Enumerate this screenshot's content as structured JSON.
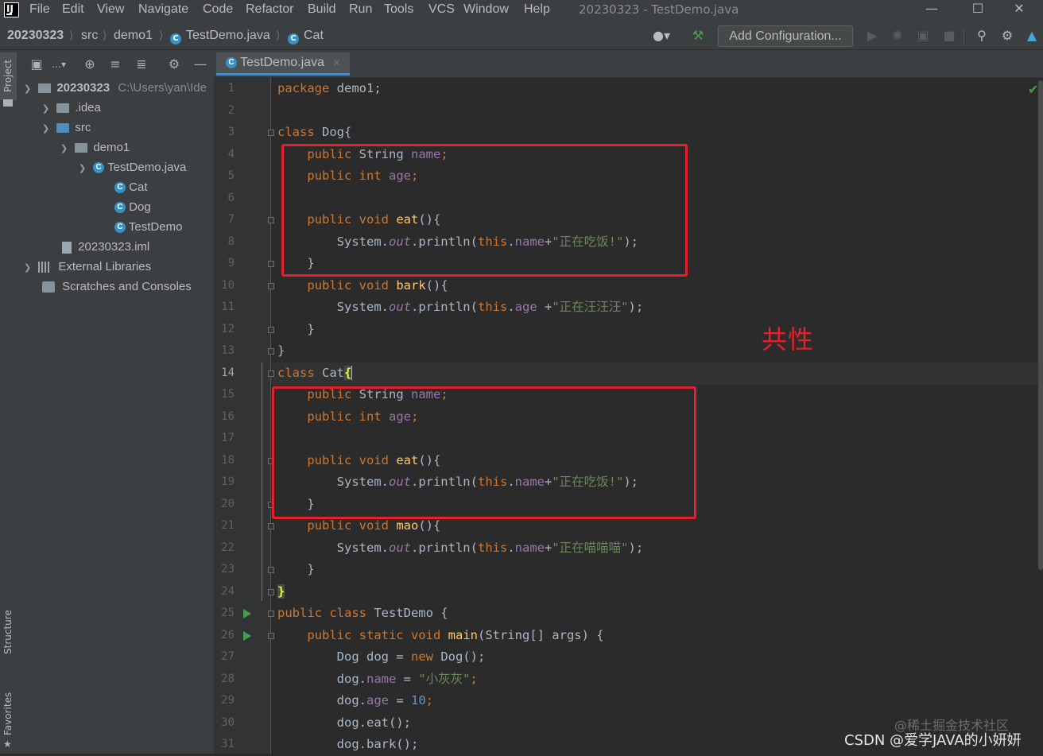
{
  "menubar": {
    "items": [
      "File",
      "Edit",
      "View",
      "Navigate",
      "Code",
      "Refactor",
      "Build",
      "Run",
      "Tools",
      "VCS",
      "Window",
      "Help"
    ],
    "window_title": "20230323 - TestDemo.java",
    "logo_text": "IJ"
  },
  "navbar": {
    "crumbs": [
      "20230323",
      "src",
      "demo1",
      "TestDemo.java",
      "Cat"
    ],
    "add_configuration": "Add Configuration..."
  },
  "stripe": {
    "project": "Project",
    "structure": "Structure",
    "favorites": "Favorites"
  },
  "tree": {
    "root_name": "20230323",
    "root_path": "C:\\Users\\yan\\Ide",
    "idea": ".idea",
    "src": "src",
    "demo1": "demo1",
    "testdemo_java": "TestDemo.java",
    "cat": "Cat",
    "dog": "Dog",
    "testdemo": "TestDemo",
    "iml": "20230323.iml",
    "external_libraries": "External Libraries",
    "scratches": "Scratches and Consoles"
  },
  "editor": {
    "tab_label": "TestDemo.java",
    "line_numbers": [
      "1",
      "2",
      "3",
      "4",
      "5",
      "6",
      "7",
      "8",
      "9",
      "10",
      "11",
      "12",
      "13",
      "14",
      "15",
      "16",
      "17",
      "18",
      "19",
      "20",
      "21",
      "22",
      "23",
      "24",
      "25",
      "26",
      "27",
      "28",
      "29",
      "30",
      "31"
    ],
    "code": {
      "l1a": "package",
      "l1b": " demo1;",
      "l3a": "class",
      "l3b": " Dog{",
      "l4a": "    public",
      "l4b": " String ",
      "l4c": "name",
      "l4d": ";",
      "l5a": "    public int",
      "l5b": " ",
      "l5c": "age",
      "l5d": ";",
      "l7a": "    public void",
      "l7b": " ",
      "l7c": "eat",
      "l7d": "(){",
      "l8a": "        System.",
      "l8b": "out",
      "l8c": ".println(",
      "l8d": "this",
      "l8e": ".",
      "l8f": "name",
      "l8g": "+",
      "l8h": "\"正在吃饭!\"",
      "l8i": ");",
      "l9": "    }",
      "l10a": "    public void",
      "l10b": " ",
      "l10c": "bark",
      "l10d": "(){",
      "l11a": "        System.",
      "l11b": "out",
      "l11c": ".println(",
      "l11d": "this",
      "l11e": ".",
      "l11f": "age",
      "l11g": " +",
      "l11h": "\"正在汪汪汪\"",
      "l11i": ");",
      "l12": "    }",
      "l13": "}",
      "l14a": "class",
      "l14b": " Cat",
      "l14c": "{",
      "l15a": "    public",
      "l15b": " String ",
      "l15c": "name",
      "l15d": ";",
      "l16a": "    public int",
      "l16b": " ",
      "l16c": "age",
      "l16d": ";",
      "l18a": "    public void",
      "l18b": " ",
      "l18c": "eat",
      "l18d": "(){",
      "l19a": "        System.",
      "l19b": "out",
      "l19c": ".println(",
      "l19d": "this",
      "l19e": ".",
      "l19f": "name",
      "l19g": "+",
      "l19h": "\"正在吃饭!\"",
      "l19i": ");",
      "l20": "    }",
      "l21a": "    public void",
      "l21b": " ",
      "l21c": "mao",
      "l21d": "(){",
      "l22a": "        System.",
      "l22b": "out",
      "l22c": ".println(",
      "l22d": "this",
      "l22e": ".",
      "l22f": "name",
      "l22g": "+",
      "l22h": "\"正在喵喵喵\"",
      "l22i": ");",
      "l23": "    }",
      "l24": "}",
      "l25a": "public class",
      "l25b": " TestDemo {",
      "l26a": "    public static void",
      "l26b": " ",
      "l26c": "main",
      "l26d": "(String[] args) {",
      "l27a": "        Dog dog = ",
      "l27b": "new",
      "l27c": " Dog();",
      "l28a": "        dog.",
      "l28b": "name",
      "l28c": " = ",
      "l28d": "\"小灰灰\"",
      "l28e": ";",
      "l29a": "        dog.",
      "l29b": "age",
      "l29c": " = ",
      "l29d": "10",
      "l29e": ";",
      "l30": "        dog.eat();",
      "l31": "        dog.bark();"
    }
  },
  "annotation": {
    "text": "共性"
  },
  "watermark": {
    "line1": "@稀土掘金技术社区",
    "line2": "CSDN @爱学JAVA的小妍妍"
  },
  "colors": {
    "keyword": "#cc7832",
    "field": "#9876aa",
    "method": "#ffc66d",
    "string": "#6a8759",
    "number": "#6897bb",
    "highlight_box": "#e3202b"
  }
}
